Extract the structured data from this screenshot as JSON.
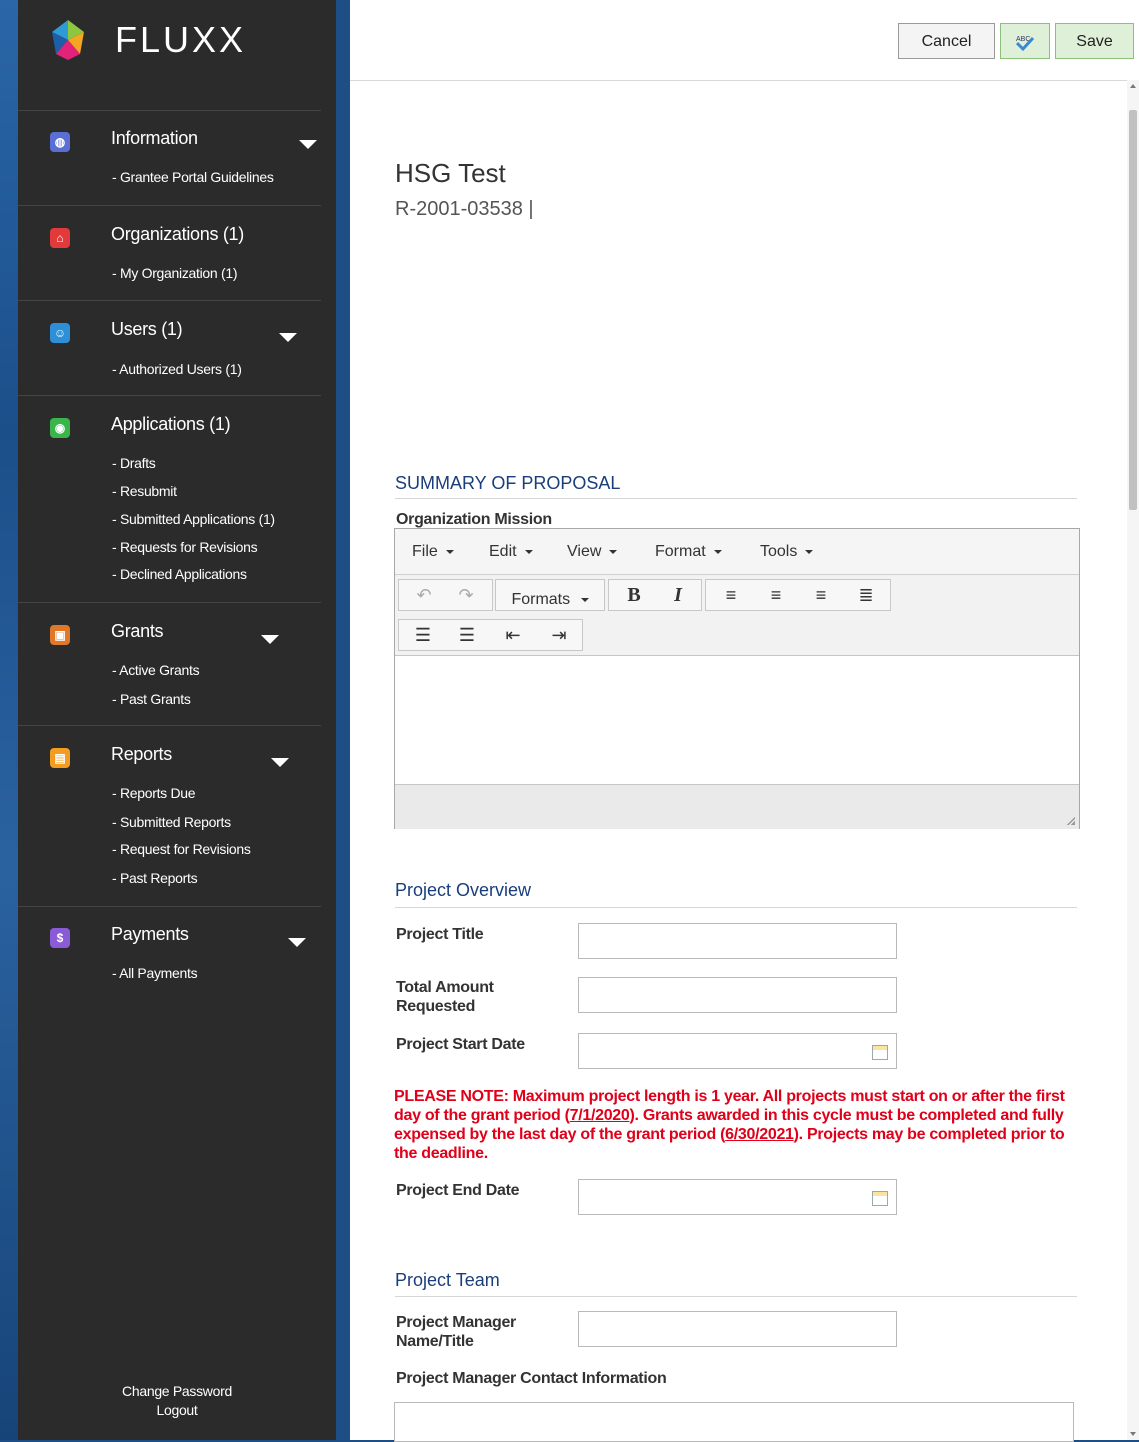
{
  "app": {
    "brand": "FLUXX"
  },
  "sidebar": {
    "sections": [
      {
        "title": "Information",
        "icon": "info-icon",
        "items": [
          "- Grantee Portal Guidelines"
        ]
      },
      {
        "title": "Organizations (1)",
        "icon": "organization-icon",
        "items": [
          "- My Organization  (1)"
        ]
      },
      {
        "title": "Users (1)",
        "icon": "users-icon",
        "items": [
          "- Authorized Users  (1)"
        ]
      },
      {
        "title": "Applications (1)",
        "icon": "applications-icon",
        "items": [
          "- Drafts",
          "- Resubmit",
          "- Submitted Applications  (1)",
          "- Requests for Revisions",
          "- Declined Applications"
        ]
      },
      {
        "title": "Grants",
        "icon": "grants-icon",
        "items": [
          "- Active Grants",
          "- Past Grants"
        ]
      },
      {
        "title": "Reports",
        "icon": "reports-icon",
        "items": [
          "- Reports Due",
          "- Submitted Reports",
          "- Request for Revisions",
          "- Past Reports"
        ]
      },
      {
        "title": "Payments",
        "icon": "payments-icon",
        "items": [
          "- All Payments"
        ]
      }
    ],
    "footer": {
      "change_password": "Change Password",
      "logout": "Logout"
    }
  },
  "toolbar": {
    "cancel": "Cancel",
    "spellcheck": "ABC",
    "save": "Save"
  },
  "record": {
    "title": "HSG Test",
    "ref": "R-2001-03538 |"
  },
  "summary": {
    "heading": "SUMMARY OF PROPOSAL",
    "mission_label": "Organization Mission",
    "editor": {
      "menus": [
        "File",
        "Edit",
        "View",
        "Format",
        "Tools"
      ],
      "formats": "Formats"
    }
  },
  "overview": {
    "heading": "Project Overview",
    "project_title": "Project Title",
    "amount_line1": "Total Amount",
    "amount_line2": "Requested",
    "start_date": "Project Start Date",
    "end_date": "Project End Date",
    "note_part1": "PLEASE NOTE: Maximum project length is 1 year. All projects must start on or after the first day of the grant period (",
    "note_date1": "7/1/2020",
    "note_part2": "). Grants awarded in this cycle must be completed and fully expensed by the last day of the grant period (",
    "note_date2": "6/30/2021",
    "note_part3": "). Projects may be completed prior to the deadline."
  },
  "team": {
    "heading": "Project Team",
    "manager_line1": "Project Manager",
    "manager_line2": "Name/Title",
    "contact": "Project Manager Contact Information"
  }
}
